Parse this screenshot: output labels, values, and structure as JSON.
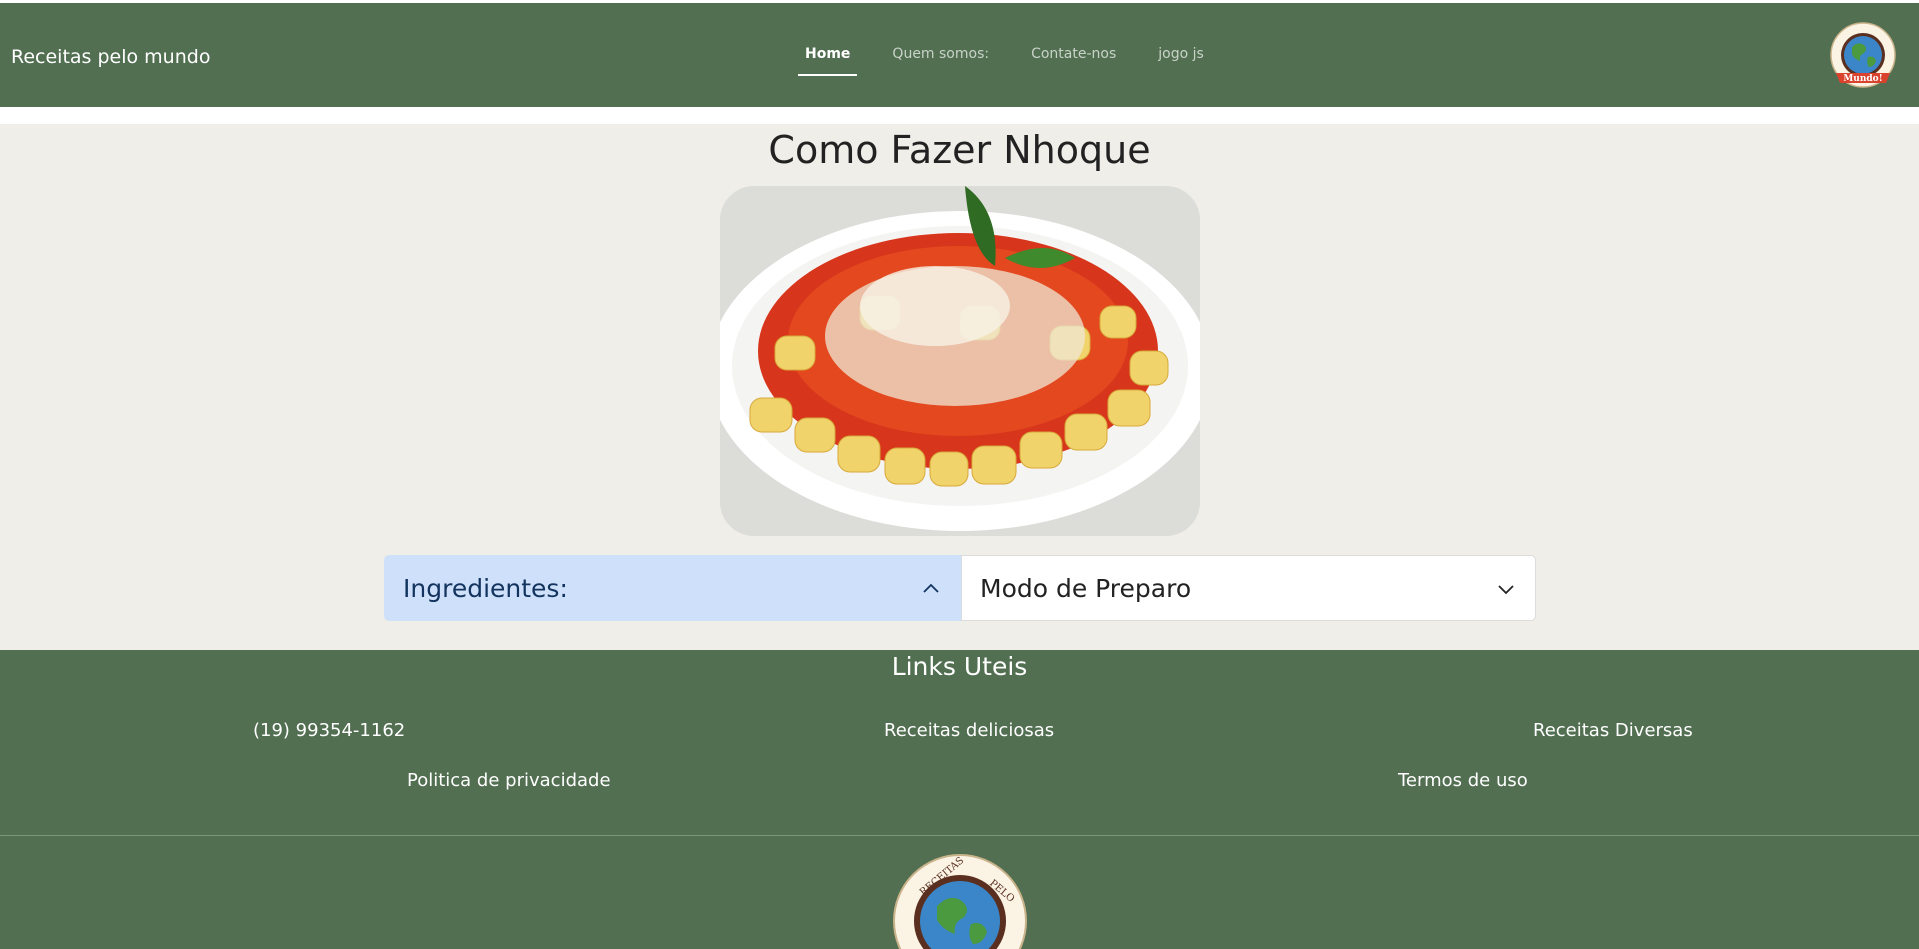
{
  "navbar": {
    "brand": "Receitas pelo mundo",
    "links": [
      {
        "label": "Home",
        "active": true
      },
      {
        "label": "Quem somos:",
        "active": false
      },
      {
        "label": "Contate-nos",
        "active": false
      },
      {
        "label": "jogo js",
        "active": false
      }
    ],
    "logo_icon": "globe-logo-icon",
    "logo_text": "Mundo!"
  },
  "main": {
    "title": "Como Fazer Nhoque",
    "image_icon": "gnocchi-dish-image",
    "accordion": [
      {
        "label": "Ingredientes:",
        "expanded": true,
        "icon": "chevron-up-icon"
      },
      {
        "label": "Modo de Preparo",
        "expanded": false,
        "icon": "chevron-down-icon"
      }
    ]
  },
  "footer": {
    "title": "Links Uteis",
    "links": {
      "phone": "(19) 99354-1162",
      "receitas_deliciosas": "Receitas deliciosas",
      "receitas_diversas": "Receitas Diversas",
      "privacidade": "Politica de privacidade",
      "termos": "Termos de uso"
    },
    "logo_text_left": "RECEITAS",
    "logo_text_right": "PELO"
  },
  "colors": {
    "nav_footer_bg": "#526f52",
    "main_bg": "#efeee8",
    "accordion_active_bg": "#cfe0fa"
  }
}
